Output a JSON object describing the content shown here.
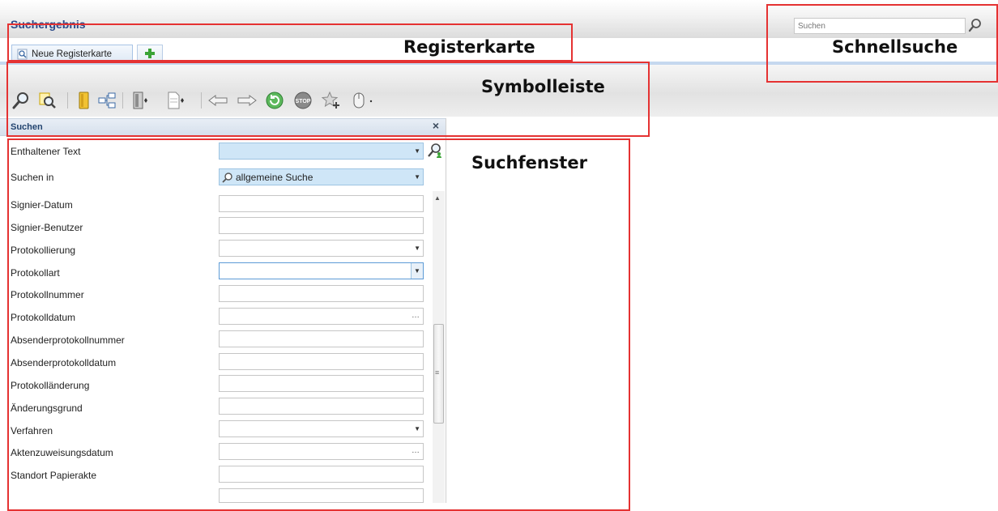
{
  "header": {
    "title": "Suchergebnis",
    "quick_search_placeholder": "Suchen"
  },
  "tabs": [
    {
      "label": "Neue Registerkarte"
    }
  ],
  "toolbar": {
    "icons": [
      "search-icon",
      "search-highlight-icon",
      "folder-icon",
      "tree-icon",
      "document-stack-icon",
      "page-icon",
      "arrow-left-icon",
      "arrow-right-icon",
      "refresh-icon",
      "stop-icon",
      "favorite-add-icon",
      "mouse-icon"
    ]
  },
  "search_panel": {
    "title": "Suchen",
    "close_label": "×",
    "search_in_value": "allgemeine Suche",
    "fields": [
      {
        "label": "Enthaltener Text"
      },
      {
        "label": "Suchen in"
      },
      {
        "label": "Signier-Datum"
      },
      {
        "label": "Signier-Benutzer"
      },
      {
        "label": "Protokollierung"
      },
      {
        "label": "Protokollart"
      },
      {
        "label": "Protokollnummer"
      },
      {
        "label": "Protokolldatum"
      },
      {
        "label": "Absenderprotokollnummer"
      },
      {
        "label": "Absenderprotokolldatum"
      },
      {
        "label": "Protokolländerung"
      },
      {
        "label": "Änderungsgrund"
      },
      {
        "label": "Verfahren"
      },
      {
        "label": "Aktenzuweisungsdatum"
      },
      {
        "label": "Standort Papierakte"
      }
    ]
  },
  "annotations": {
    "registerkarte": "Registerkarte",
    "schnellsuche": "Schnellsuche",
    "symbolleiste": "Symbolleiste",
    "suchfenster": "Suchfenster"
  },
  "colors": {
    "annotation_red": "#e53232",
    "title_blue": "#2a4a8a",
    "field_highlight": "#cfe6f7"
  }
}
